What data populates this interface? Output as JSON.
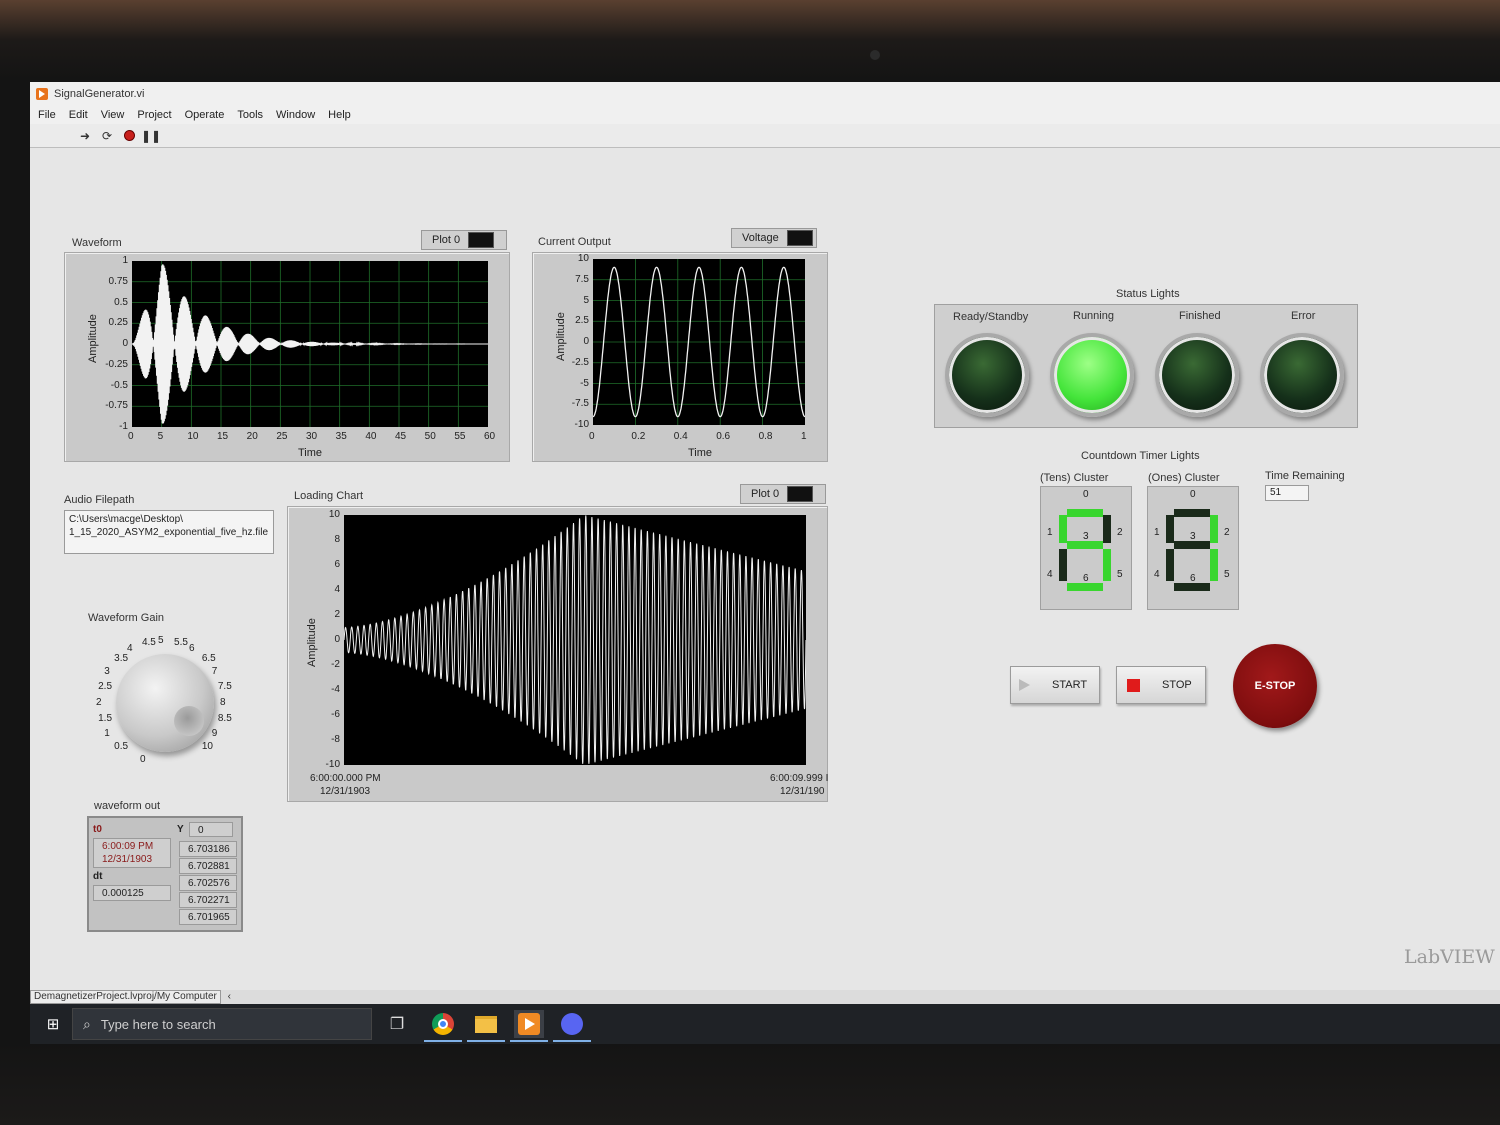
{
  "window": {
    "title": "SignalGenerator.vi"
  },
  "menu": [
    "File",
    "Edit",
    "View",
    "Project",
    "Operate",
    "Tools",
    "Window",
    "Help"
  ],
  "waveform_graph": {
    "label": "Waveform",
    "legend": "Plot 0",
    "xlabel": "Time",
    "ylabel": "Amplitude",
    "x_ticks": [
      "0",
      "5",
      "10",
      "15",
      "20",
      "25",
      "30",
      "35",
      "40",
      "45",
      "50",
      "55",
      "60"
    ],
    "y_ticks": [
      "1",
      "0.75",
      "0.5",
      "0.25",
      "0",
      "-0.25",
      "-0.5",
      "-0.75",
      "-1"
    ]
  },
  "current_output": {
    "label": "Current Output",
    "legend": "Voltage",
    "xlabel": "Time",
    "ylabel": "Amplitude",
    "x_ticks": [
      "0",
      "0.2",
      "0.4",
      "0.6",
      "0.8",
      "1"
    ],
    "y_ticks": [
      "10",
      "7.5",
      "5",
      "2.5",
      "0",
      "-2.5",
      "-5",
      "-7.5",
      "-10"
    ]
  },
  "loading_chart": {
    "label": "Loading Chart",
    "legend": "Plot 0",
    "ylabel": "Amplitude",
    "y_ticks": [
      "10",
      "8",
      "6",
      "4",
      "2",
      "0",
      "-2",
      "-4",
      "-6",
      "-8",
      "-10"
    ],
    "x_start": "6:00:00.000 PM",
    "x_start_date": "12/31/1903",
    "x_end": "6:00:09.999 I",
    "x_end_date": "12/31/190"
  },
  "audio_filepath": {
    "label": "Audio Filepath",
    "line1": "C:\\Users\\macge\\Desktop\\",
    "line2": "1_15_2020_ASYM2_exponential_five_hz.file"
  },
  "gain_knob": {
    "label": "Waveform Gain",
    "scale": [
      "0.5",
      "1",
      "1.5",
      "2",
      "2.5",
      "3",
      "3.5",
      "4",
      "4.5",
      "5",
      "5.5",
      "6",
      "6.5",
      "7",
      "7.5",
      "8",
      "8.5",
      "9",
      "10",
      "0"
    ]
  },
  "waveform_out": {
    "label": "waveform out",
    "t0_label": "t0",
    "t0_time": "6:00:09 PM",
    "t0_date": "12/31/1903",
    "dt_label": "dt",
    "dt_value": "0.000125",
    "y_label": "Y",
    "y_index": "0",
    "y_values": [
      "6.703186",
      "6.702881",
      "6.702576",
      "6.702271",
      "6.701965"
    ]
  },
  "status_lights": {
    "title": "Status Lights",
    "lights": [
      {
        "label": "Ready/Standby",
        "state": "off"
      },
      {
        "label": "Running",
        "state": "on"
      },
      {
        "label": "Finished",
        "state": "off"
      },
      {
        "label": "Error",
        "state": "off"
      }
    ]
  },
  "countdown": {
    "title": "Countdown Timer Lights",
    "tens_label": "(Tens) Cluster",
    "ones_label": "(Ones) Cluster",
    "seg_labels": [
      "0",
      "1",
      "2",
      "3",
      "4",
      "5",
      "6"
    ],
    "time_remaining_label": "Time Remaining",
    "time_remaining": "51"
  },
  "buttons": {
    "start": "START",
    "stop": "STOP",
    "estop": "E-STOP"
  },
  "branding": "LabVIEW",
  "statusbar": {
    "project": "DemagnetizerProject.lvproj/My Computer"
  },
  "taskbar": {
    "search_placeholder": "Type here to search"
  },
  "colors": {
    "led_on": "#45e53b",
    "led_off": "#15301a",
    "estop": "#7d0d0e",
    "plot_bg": "#000000",
    "grid": "#1f6e2a"
  }
}
